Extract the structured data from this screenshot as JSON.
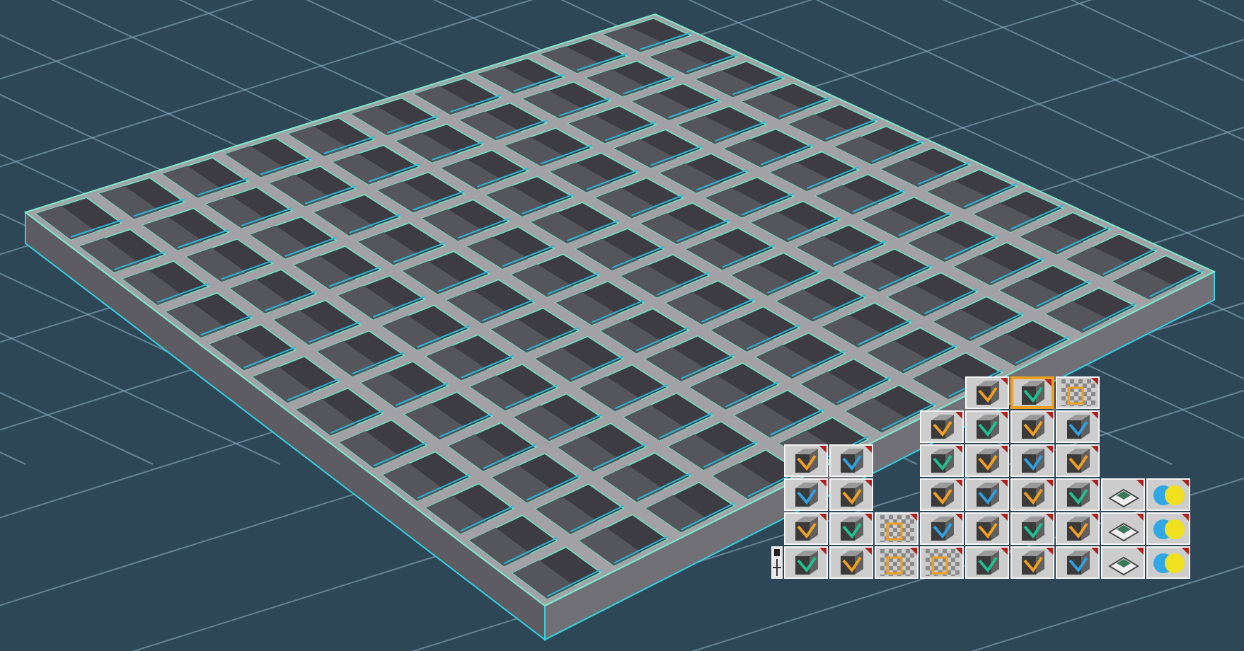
{
  "tool_palette": {
    "rows": [
      [
        {
          "kind": "gap"
        },
        {
          "kind": "gap"
        },
        {
          "kind": "gap"
        },
        {
          "kind": "gap"
        },
        {
          "kind": "cube",
          "selected": false
        },
        {
          "kind": "cube",
          "selected": true
        },
        {
          "kind": "checker",
          "selected": false
        }
      ],
      [
        {
          "kind": "gap"
        },
        {
          "kind": "gap"
        },
        {
          "kind": "gap"
        },
        {
          "kind": "cube",
          "selected": false
        },
        {
          "kind": "cube",
          "selected": false
        },
        {
          "kind": "cube",
          "selected": false
        },
        {
          "kind": "cube",
          "selected": false
        }
      ],
      [
        {
          "kind": "cube",
          "selected": false
        },
        {
          "kind": "cube",
          "selected": false
        },
        {
          "kind": "gap"
        },
        {
          "kind": "cube",
          "selected": false
        },
        {
          "kind": "cube",
          "selected": false
        },
        {
          "kind": "cube",
          "selected": false
        },
        {
          "kind": "cube",
          "selected": false
        }
      ],
      [
        {
          "kind": "cube",
          "selected": false
        },
        {
          "kind": "cube",
          "selected": false
        },
        {
          "kind": "gap"
        },
        {
          "kind": "cube",
          "selected": false
        },
        {
          "kind": "cube",
          "selected": false
        },
        {
          "kind": "cube",
          "selected": false
        },
        {
          "kind": "cube",
          "selected": false
        },
        {
          "kind": "pad",
          "selected": false
        },
        {
          "kind": "spheres",
          "selected": false
        }
      ],
      [
        {
          "kind": "cube",
          "selected": false
        },
        {
          "kind": "cube",
          "selected": false
        },
        {
          "kind": "checker",
          "selected": false
        },
        {
          "kind": "cube",
          "selected": false
        },
        {
          "kind": "cube",
          "selected": false
        },
        {
          "kind": "cube",
          "selected": false
        },
        {
          "kind": "cube",
          "selected": false
        },
        {
          "kind": "pad",
          "selected": false
        },
        {
          "kind": "spheres",
          "selected": false
        }
      ],
      [
        {
          "kind": "cube",
          "selected": false
        },
        {
          "kind": "cube",
          "selected": false
        },
        {
          "kind": "checker",
          "selected": false
        },
        {
          "kind": "checker",
          "selected": false
        },
        {
          "kind": "cube",
          "selected": false
        },
        {
          "kind": "cube",
          "selected": false
        },
        {
          "kind": "cube",
          "selected": false
        },
        {
          "kind": "pad",
          "selected": false
        },
        {
          "kind": "spheres",
          "selected": false
        }
      ]
    ]
  }
}
